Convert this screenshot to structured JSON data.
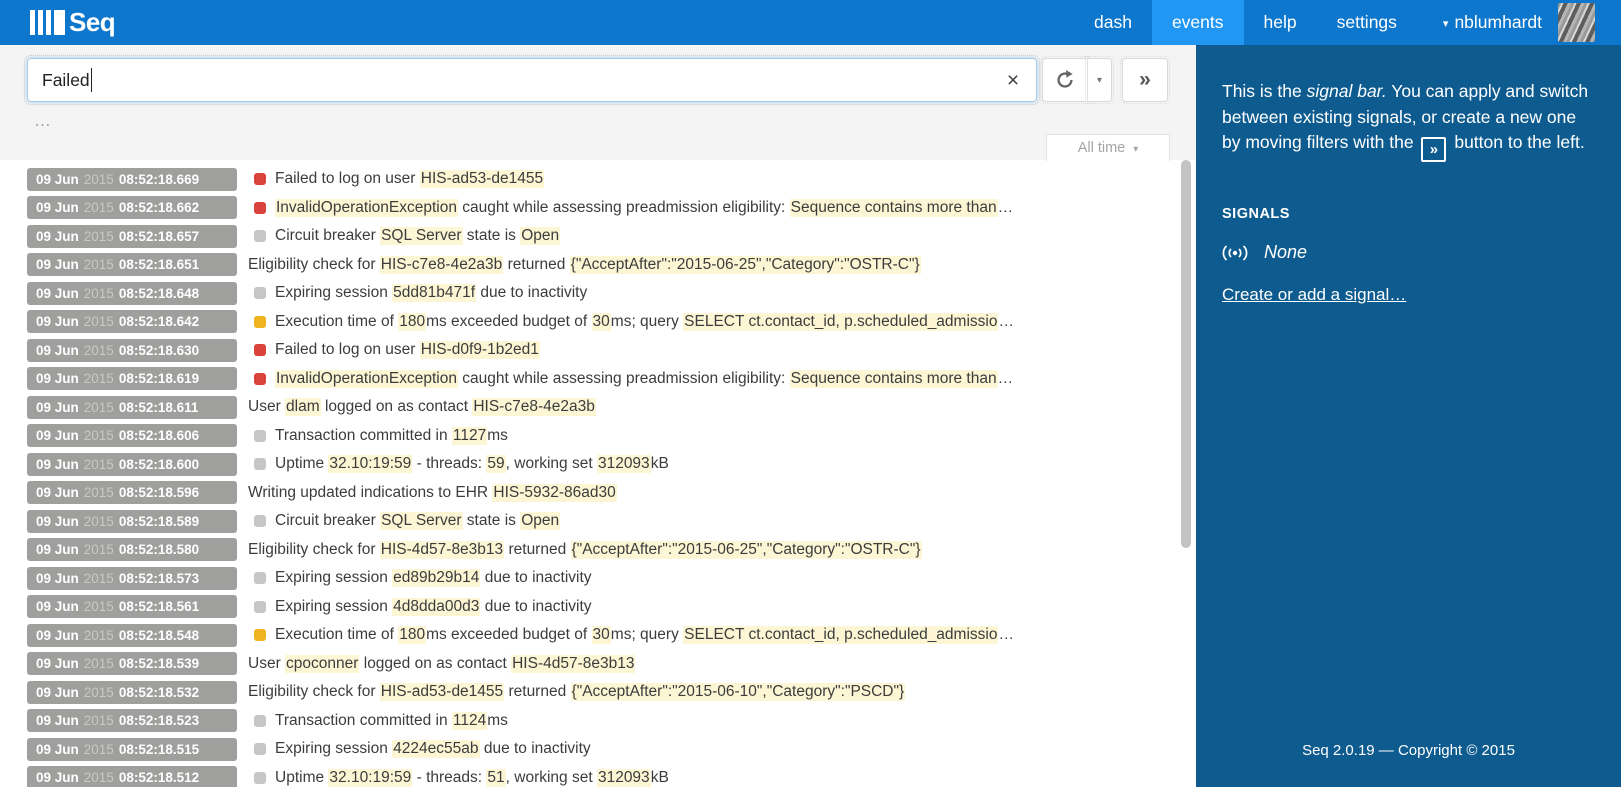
{
  "topbar": {
    "logo_text": "Seq",
    "nav": [
      {
        "label": "dash",
        "active": false
      },
      {
        "label": "events",
        "active": true
      },
      {
        "label": "help",
        "active": false
      },
      {
        "label": "settings",
        "active": false
      }
    ],
    "user": {
      "name": "nblumhardt"
    }
  },
  "search": {
    "value": "Failed",
    "clear_label": "×",
    "refresh_icon": "refresh",
    "dropdown_caret": "▾",
    "push_label": "»",
    "more_label": "…"
  },
  "range_button": {
    "label": "All time",
    "caret": "▾"
  },
  "events": {
    "date": "09 Jun",
    "year": "2015",
    "rows": [
      {
        "time": "08:52:18.669",
        "level": "error",
        "segments": [
          {
            "h": false,
            "t": "Failed to log on user "
          },
          {
            "h": true,
            "t": "HIS-ad53-de1455"
          }
        ]
      },
      {
        "time": "08:52:18.662",
        "level": "error",
        "segments": [
          {
            "h": true,
            "t": "InvalidOperationException"
          },
          {
            "h": false,
            "t": " caught while assessing preadmission eligibility: "
          },
          {
            "h": true,
            "t": "Sequence contains more than"
          },
          {
            "h": false,
            "t": "…"
          }
        ]
      },
      {
        "time": "08:52:18.657",
        "level": "debug",
        "segments": [
          {
            "h": false,
            "t": "Circuit breaker "
          },
          {
            "h": true,
            "t": "SQL Server"
          },
          {
            "h": false,
            "t": " state is "
          },
          {
            "h": true,
            "t": "Open"
          }
        ]
      },
      {
        "time": "08:52:18.651",
        "level": "none",
        "segments": [
          {
            "h": false,
            "t": "Eligibility check for "
          },
          {
            "h": true,
            "t": "HIS-c7e8-4e2a3b"
          },
          {
            "h": false,
            "t": " returned "
          },
          {
            "h": true,
            "t": "{\"AcceptAfter\":\"2015-06-25\",\"Category\":\"OSTR-C\"}"
          }
        ]
      },
      {
        "time": "08:52:18.648",
        "level": "debug",
        "segments": [
          {
            "h": false,
            "t": "Expiring session "
          },
          {
            "h": true,
            "t": "5dd81b471f"
          },
          {
            "h": false,
            "t": " due to inactivity"
          }
        ]
      },
      {
        "time": "08:52:18.642",
        "level": "warning",
        "segments": [
          {
            "h": false,
            "t": "Execution time of "
          },
          {
            "h": true,
            "t": "180"
          },
          {
            "h": false,
            "t": "ms exceeded budget of "
          },
          {
            "h": true,
            "t": "30"
          },
          {
            "h": false,
            "t": "ms; query "
          },
          {
            "h": true,
            "t": "SELECT ct.contact_id, p.scheduled_admissio"
          },
          {
            "h": false,
            "t": "…"
          }
        ]
      },
      {
        "time": "08:52:18.630",
        "level": "error",
        "segments": [
          {
            "h": false,
            "t": "Failed to log on user "
          },
          {
            "h": true,
            "t": "HIS-d0f9-1b2ed1"
          }
        ]
      },
      {
        "time": "08:52:18.619",
        "level": "error",
        "segments": [
          {
            "h": true,
            "t": "InvalidOperationException"
          },
          {
            "h": false,
            "t": " caught while assessing preadmission eligibility: "
          },
          {
            "h": true,
            "t": "Sequence contains more than"
          },
          {
            "h": false,
            "t": "…"
          }
        ]
      },
      {
        "time": "08:52:18.611",
        "level": "none",
        "segments": [
          {
            "h": false,
            "t": "User "
          },
          {
            "h": true,
            "t": "dlam"
          },
          {
            "h": false,
            "t": " logged on as contact "
          },
          {
            "h": true,
            "t": "HIS-c7e8-4e2a3b"
          }
        ]
      },
      {
        "time": "08:52:18.606",
        "level": "debug",
        "segments": [
          {
            "h": false,
            "t": "Transaction committed in "
          },
          {
            "h": true,
            "t": "1127"
          },
          {
            "h": false,
            "t": "ms"
          }
        ]
      },
      {
        "time": "08:52:18.600",
        "level": "debug",
        "segments": [
          {
            "h": false,
            "t": "Uptime "
          },
          {
            "h": true,
            "t": "32.10:19:59"
          },
          {
            "h": false,
            "t": " - threads: "
          },
          {
            "h": true,
            "t": "59"
          },
          {
            "h": false,
            "t": ", working set "
          },
          {
            "h": true,
            "t": "312093"
          },
          {
            "h": false,
            "t": "kB"
          }
        ]
      },
      {
        "time": "08:52:18.596",
        "level": "none",
        "segments": [
          {
            "h": false,
            "t": "Writing updated indications to EHR "
          },
          {
            "h": true,
            "t": "HIS-5932-86ad30"
          }
        ]
      },
      {
        "time": "08:52:18.589",
        "level": "debug",
        "segments": [
          {
            "h": false,
            "t": "Circuit breaker "
          },
          {
            "h": true,
            "t": "SQL Server"
          },
          {
            "h": false,
            "t": " state is "
          },
          {
            "h": true,
            "t": "Open"
          }
        ]
      },
      {
        "time": "08:52:18.580",
        "level": "none",
        "segments": [
          {
            "h": false,
            "t": "Eligibility check for "
          },
          {
            "h": true,
            "t": "HIS-4d57-8e3b13"
          },
          {
            "h": false,
            "t": " returned "
          },
          {
            "h": true,
            "t": "{\"AcceptAfter\":\"2015-06-25\",\"Category\":\"OSTR-C\"}"
          }
        ]
      },
      {
        "time": "08:52:18.573",
        "level": "debug",
        "segments": [
          {
            "h": false,
            "t": "Expiring session "
          },
          {
            "h": true,
            "t": "ed89b29b14"
          },
          {
            "h": false,
            "t": " due to inactivity"
          }
        ]
      },
      {
        "time": "08:52:18.561",
        "level": "debug",
        "segments": [
          {
            "h": false,
            "t": "Expiring session "
          },
          {
            "h": true,
            "t": "4d8dda00d3"
          },
          {
            "h": false,
            "t": " due to inactivity"
          }
        ]
      },
      {
        "time": "08:52:18.548",
        "level": "warning",
        "segments": [
          {
            "h": false,
            "t": "Execution time of "
          },
          {
            "h": true,
            "t": "180"
          },
          {
            "h": false,
            "t": "ms exceeded budget of "
          },
          {
            "h": true,
            "t": "30"
          },
          {
            "h": false,
            "t": "ms; query "
          },
          {
            "h": true,
            "t": "SELECT ct.contact_id, p.scheduled_admissio"
          },
          {
            "h": false,
            "t": "…"
          }
        ]
      },
      {
        "time": "08:52:18.539",
        "level": "none",
        "segments": [
          {
            "h": false,
            "t": "User "
          },
          {
            "h": true,
            "t": "cpoconner"
          },
          {
            "h": false,
            "t": " logged on as contact "
          },
          {
            "h": true,
            "t": "HIS-4d57-8e3b13"
          }
        ]
      },
      {
        "time": "08:52:18.532",
        "level": "none",
        "segments": [
          {
            "h": false,
            "t": "Eligibility check for "
          },
          {
            "h": true,
            "t": "HIS-ad53-de1455"
          },
          {
            "h": false,
            "t": " returned "
          },
          {
            "h": true,
            "t": "{\"AcceptAfter\":\"2015-06-10\",\"Category\":\"PSCD\"}"
          }
        ]
      },
      {
        "time": "08:52:18.523",
        "level": "debug",
        "segments": [
          {
            "h": false,
            "t": "Transaction committed in "
          },
          {
            "h": true,
            "t": "1124"
          },
          {
            "h": false,
            "t": "ms"
          }
        ]
      },
      {
        "time": "08:52:18.515",
        "level": "debug",
        "segments": [
          {
            "h": false,
            "t": "Expiring session "
          },
          {
            "h": true,
            "t": "4224ec55ab"
          },
          {
            "h": false,
            "t": " due to inactivity"
          }
        ]
      },
      {
        "time": "08:52:18.512",
        "level": "debug",
        "segments": [
          {
            "h": false,
            "t": "Uptime "
          },
          {
            "h": true,
            "t": "32.10:19:59"
          },
          {
            "h": false,
            "t": " - threads: "
          },
          {
            "h": true,
            "t": "51"
          },
          {
            "h": false,
            "t": ", working set "
          },
          {
            "h": true,
            "t": "312093"
          },
          {
            "h": false,
            "t": "kB"
          }
        ]
      }
    ]
  },
  "signalbar": {
    "intro_pre": "This is the ",
    "intro_em": "signal bar.",
    "intro_mid": " You can apply and switch between existing signals, or create a new one by moving filters with the ",
    "intro_button": "»",
    "intro_post": " button to the left.",
    "signals_heading": "SIGNALS",
    "none_label": "None",
    "create_link": "Create or add a signal…",
    "footer": "Seq 2.0.19 — Copyright © 2015"
  },
  "colors": {
    "topbar": "#0d76cd",
    "active_tab": "#2196f3",
    "sidebar": "#0e5c8f",
    "highlight": "#fcf6d5",
    "level_error": "#d9433b",
    "level_warning": "#efb320",
    "level_debug": "#c6c6c6",
    "timestamp_badge": "#9f9f9e"
  }
}
